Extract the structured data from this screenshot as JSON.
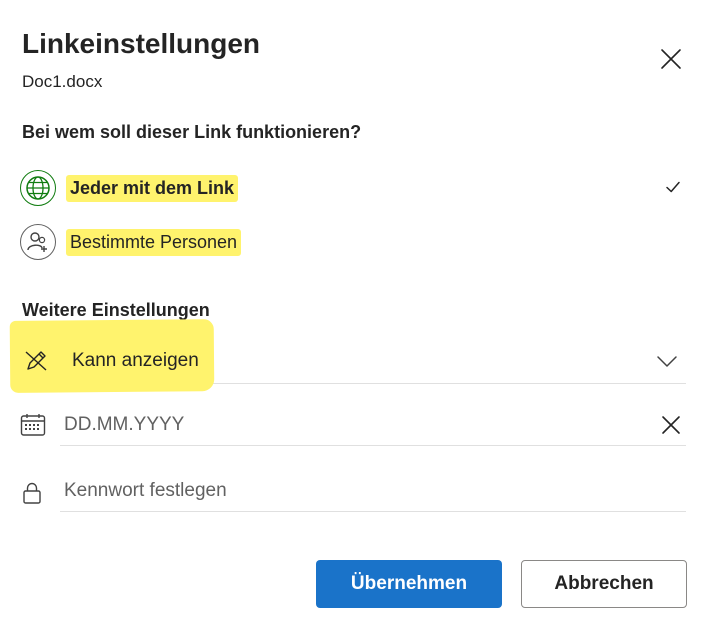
{
  "dialog": {
    "title": "Linkeinstellungen",
    "file_name": "Doc1.docx",
    "close_icon": "close-icon"
  },
  "audience": {
    "question": "Bei wem soll dieser Link funktionieren?",
    "options": [
      {
        "label": "Jeder mit dem Link",
        "icon": "globe-icon",
        "selected": true
      },
      {
        "label": "Bestimmte Personen",
        "icon": "people-add-icon",
        "selected": false
      }
    ]
  },
  "settings": {
    "title": "Weitere Einstellungen",
    "permission": {
      "value": "Kann anzeigen",
      "icon": "pencil-icon"
    },
    "expiry": {
      "placeholder": "DD.MM.YYYY",
      "icon": "calendar-icon"
    },
    "password": {
      "placeholder": "Kennwort festlegen",
      "icon": "lock-icon"
    }
  },
  "actions": {
    "apply_label": "Übernehmen",
    "cancel_label": "Abbrechen"
  },
  "colors": {
    "primary": "#1a73c9",
    "highlight": "#fff36d",
    "globe": "#107c10"
  }
}
